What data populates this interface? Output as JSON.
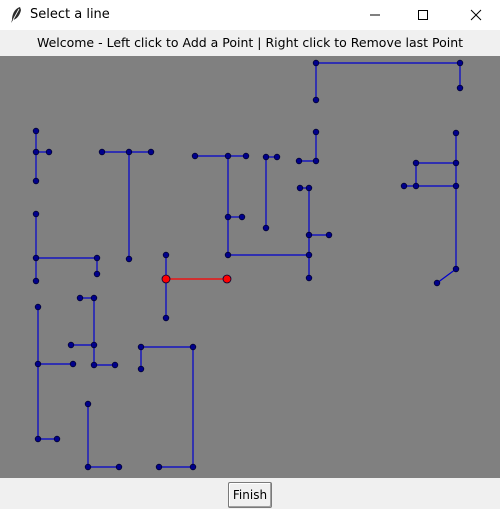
{
  "window": {
    "title": "Select a line",
    "app_icon": "feather-icon",
    "controls": [
      "minimize-icon",
      "maximize-icon",
      "close-icon"
    ]
  },
  "instruction": {
    "text": "Welcome - Left click to Add a Point | Right click to Remove last Point"
  },
  "canvas": {
    "background_color": "#808080",
    "line_color": "#0000cc",
    "point_color": "#00008b",
    "selected_color": "#ff0000",
    "point_count": 88,
    "selected_segment_count": 1
  },
  "footer": {
    "finish_label": "Finish"
  }
}
